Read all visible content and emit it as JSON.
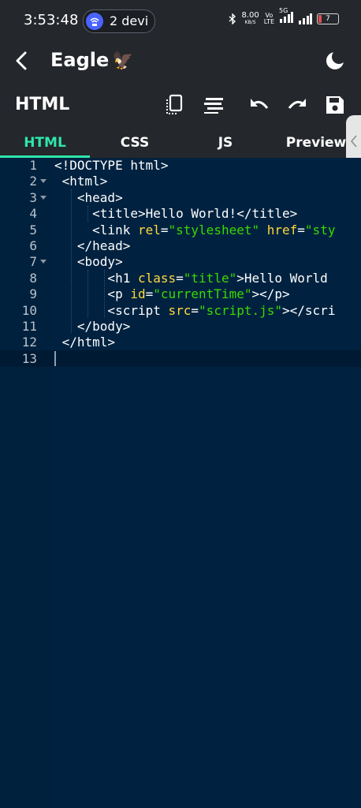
{
  "status_bar": {
    "time": "3:53:48",
    "hotspot_text": "2 devi",
    "data_speed": "8.00",
    "data_unit": "KB/S",
    "volte_top": "Vo",
    "volte_bottom": "LTE",
    "network_badge": "5G",
    "battery": "7"
  },
  "app_bar": {
    "title": "Eagle",
    "emoji": "🦅"
  },
  "toolbar": {
    "title": "HTML"
  },
  "tabs": [
    {
      "label": "HTML",
      "active": true
    },
    {
      "label": "CSS",
      "active": false
    },
    {
      "label": "JS",
      "active": false
    },
    {
      "label": "Preview",
      "active": false
    }
  ],
  "editor": {
    "lines": [
      {
        "num": "1",
        "text": "<!DOCTYPE html>"
      },
      {
        "num": "2",
        "text": " <html>"
      },
      {
        "num": "3",
        "text": "   <head>"
      },
      {
        "num": "4",
        "text": "     <title>Hello World!</title>"
      },
      {
        "num": "5",
        "text": "     <link rel=\"stylesheet\" href=\"sty"
      },
      {
        "num": "6",
        "text": "   </head>"
      },
      {
        "num": "7",
        "text": "   <body>"
      },
      {
        "num": "8",
        "text": "       <h1 class=\"title\">Hello World"
      },
      {
        "num": "9",
        "text": "       <p id=\"currentTime\"></p>"
      },
      {
        "num": "10",
        "text": "       <script src=\"script.js\"></scri"
      },
      {
        "num": "11",
        "text": "   </body>"
      },
      {
        "num": "12",
        "text": " </html>"
      },
      {
        "num": "13",
        "text": ""
      }
    ]
  },
  "colors": {
    "accent": "#2ee6a8",
    "editor_bg": "#002240",
    "attr": "#ffd93f",
    "string": "#3ad900",
    "toolbar_bg": "#24272c"
  },
  "icons": [
    "wifi-hotspot-icon",
    "bluetooth-icon",
    "signal-icon",
    "battery-icon",
    "back-arrow-icon",
    "moon-icon",
    "copy-icon",
    "format-icon",
    "undo-icon",
    "redo-icon",
    "save-icon",
    "chevron-left-icon"
  ]
}
